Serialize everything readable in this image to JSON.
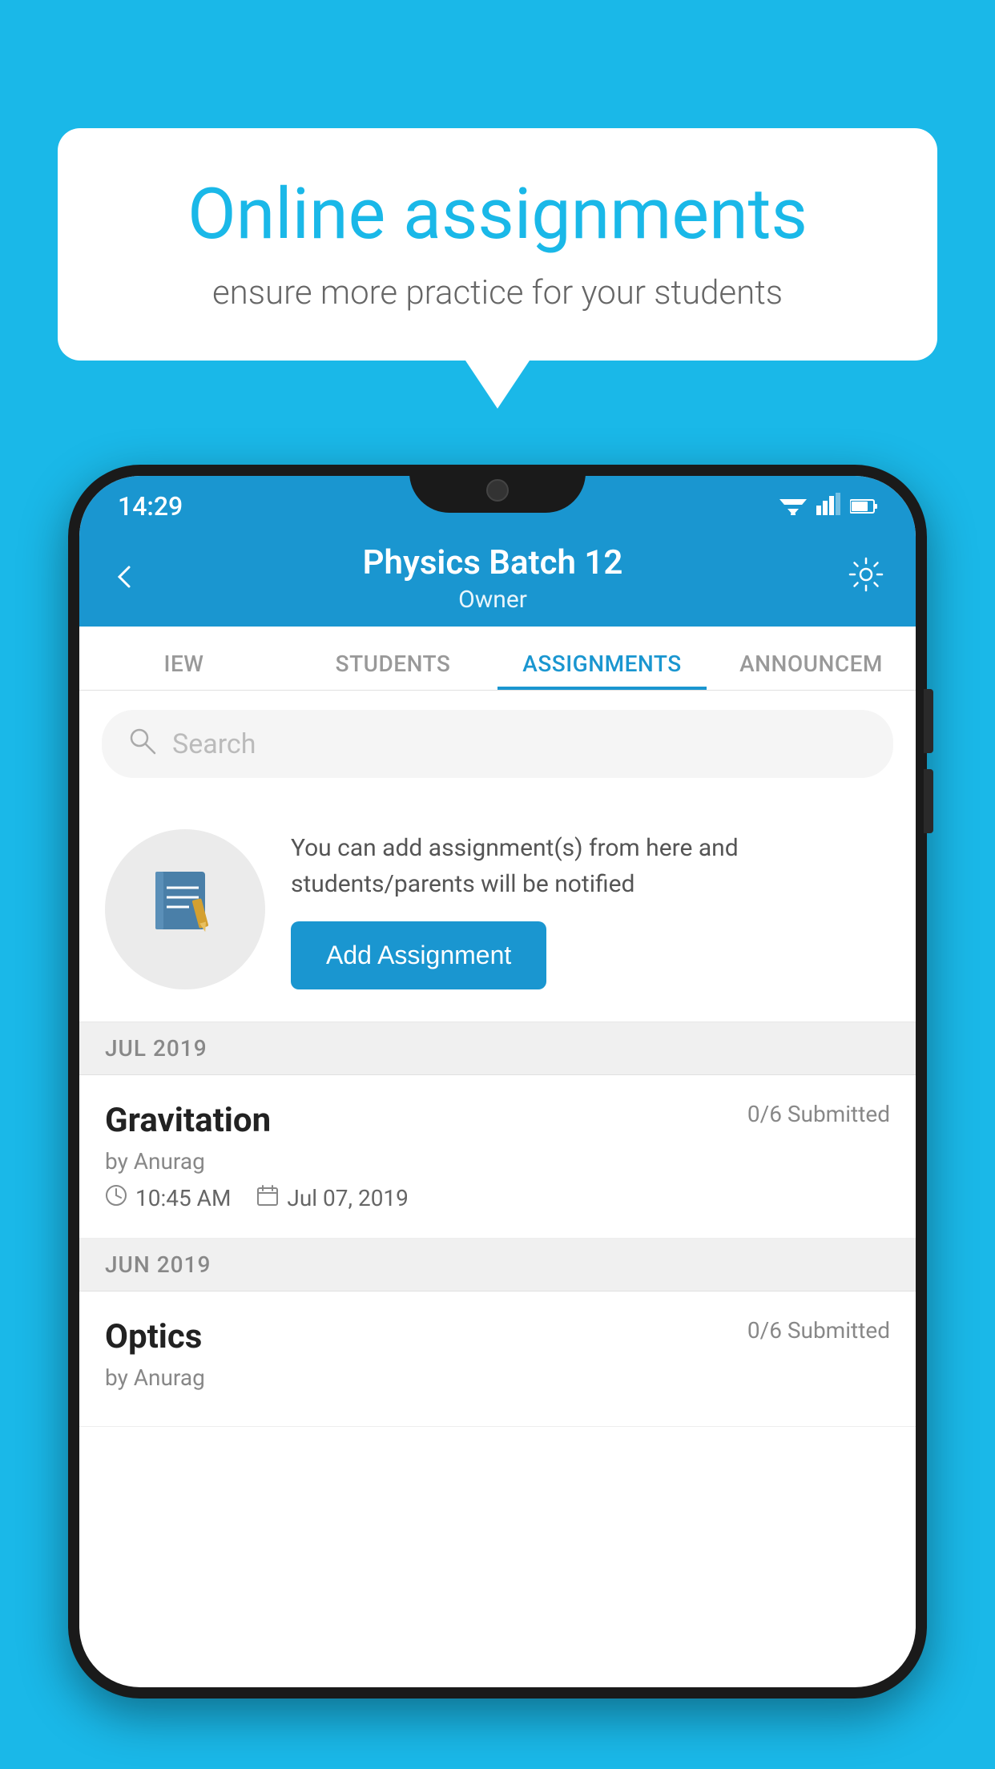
{
  "background_color": "#1ab8e8",
  "speech_bubble": {
    "title": "Online assignments",
    "subtitle": "ensure more practice for your students"
  },
  "status_bar": {
    "time": "14:29",
    "wifi": "▾",
    "signal": "▲",
    "battery": "▮"
  },
  "header": {
    "title": "Physics Batch 12",
    "subtitle": "Owner",
    "back_icon": "back-arrow",
    "settings_icon": "gear"
  },
  "tabs": [
    {
      "label": "IEW",
      "active": false
    },
    {
      "label": "STUDENTS",
      "active": false
    },
    {
      "label": "ASSIGNMENTS",
      "active": true
    },
    {
      "label": "ANNOUNCEM",
      "active": false
    }
  ],
  "search": {
    "placeholder": "Search"
  },
  "promo": {
    "text": "You can add assignment(s) from here and students/parents will be notified",
    "button_label": "Add Assignment"
  },
  "sections": [
    {
      "month_label": "JUL 2019",
      "assignments": [
        {
          "title": "Gravitation",
          "submitted": "0/6 Submitted",
          "author": "by Anurag",
          "time": "10:45 AM",
          "date": "Jul 07, 2019"
        }
      ]
    },
    {
      "month_label": "JUN 2019",
      "assignments": [
        {
          "title": "Optics",
          "submitted": "0/6 Submitted",
          "author": "by Anurag",
          "time": "",
          "date": ""
        }
      ]
    }
  ]
}
